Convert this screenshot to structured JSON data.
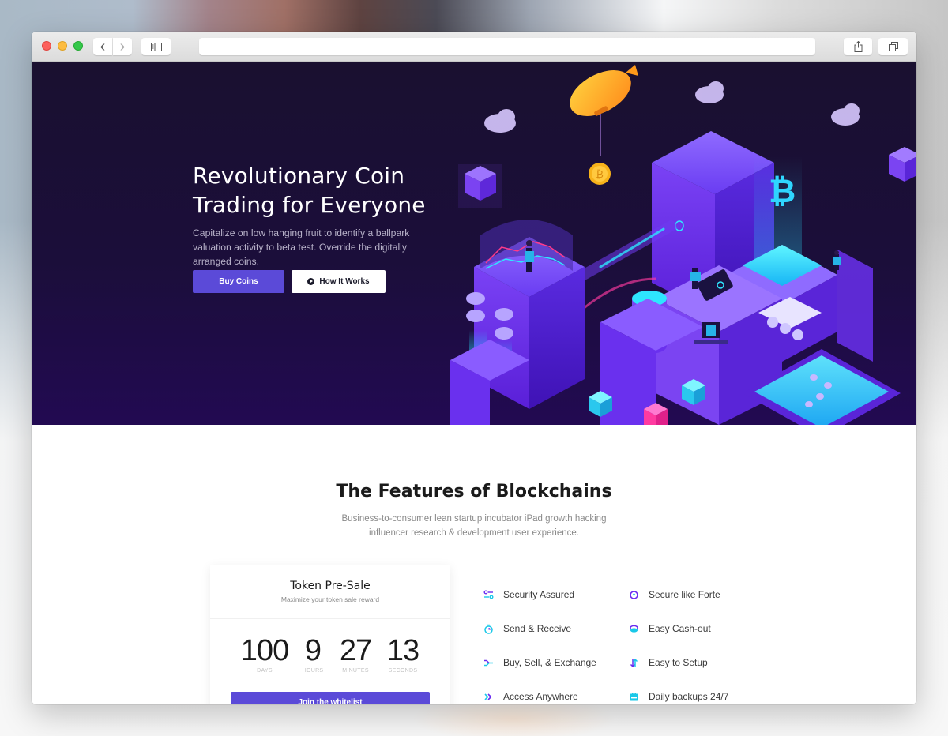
{
  "browser": {
    "back_icon": "‹",
    "forward_icon": "›",
    "address": ""
  },
  "hero": {
    "title": "Revolutionary Coin Trading for Everyone",
    "subtitle": "Capitalize on low hanging fruit to identify a ballpark valuation activity to beta test. Override the digitally arranged coins.",
    "primary_button": "Buy Coins",
    "secondary_button": "How It Works",
    "illustration": "isometric-blockchain-city-illustration"
  },
  "features": {
    "title": "The Features of Blockchains",
    "subtitle": "Business-to-consumer lean startup incubator iPad growth hacking influencer research & development user experience.",
    "items": [
      {
        "label": "Security Assured",
        "icon": "sliders-icon"
      },
      {
        "label": "Secure like Forte",
        "icon": "lock-dial-icon"
      },
      {
        "label": "Send & Receive",
        "icon": "timer-icon"
      },
      {
        "label": "Easy Cash-out",
        "icon": "coin-stack-icon"
      },
      {
        "label": "Buy, Sell, & Exchange",
        "icon": "merge-arrow-icon"
      },
      {
        "label": "Easy to Setup",
        "icon": "swap-vertical-icon"
      },
      {
        "label": "Access Anywhere",
        "icon": "double-chevron-right-icon"
      },
      {
        "label": "Daily backups 24/7",
        "icon": "calendar-icon"
      }
    ]
  },
  "presale": {
    "title": "Token Pre-Sale",
    "subtitle": "Maximize your token sale reward",
    "countdown": [
      {
        "value": "100",
        "label": "DAYS"
      },
      {
        "value": "9",
        "label": "HOURS"
      },
      {
        "value": "27",
        "label": "MINUTES"
      },
      {
        "value": "13",
        "label": "SECONDS"
      }
    ],
    "button": "Join the whitelist"
  },
  "colors": {
    "accent": "#5b4ad8",
    "hero_bg": "#1b0e3a",
    "icon_purple": "#6a2cf0",
    "icon_cyan": "#19c8e8"
  }
}
